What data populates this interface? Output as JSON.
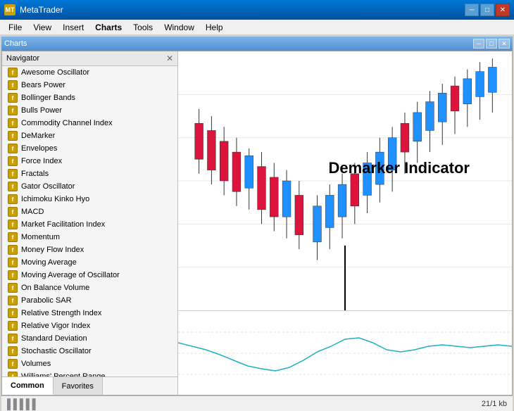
{
  "titleBar": {
    "icon": "MT",
    "title": "MetaTrader",
    "minimize": "─",
    "maximize": "□",
    "close": "✕"
  },
  "menuBar": {
    "items": [
      "File",
      "View",
      "Insert",
      "Charts",
      "Tools",
      "Window",
      "Help"
    ]
  },
  "innerWindow": {
    "title": "Charts",
    "minimize": "─",
    "maximize": "□",
    "close": "✕"
  },
  "navigator": {
    "title": "Navigator",
    "closeIcon": "✕",
    "items": [
      "Awesome Oscillator",
      "Bears Power",
      "Bollinger Bands",
      "Bulls Power",
      "Commodity Channel Index",
      "DeMarker",
      "Envelopes",
      "Force Index",
      "Fractals",
      "Gator Oscillator",
      "Ichimoku Kinko Hyo",
      "MACD",
      "Market Facilitation Index",
      "Momentum",
      "Money Flow Index",
      "Moving Average",
      "Moving Average of Oscillator",
      "On Balance Volume",
      "Parabolic SAR",
      "Relative Strength Index",
      "Relative Vigor Index",
      "Standard Deviation",
      "Stochastic Oscillator",
      "Volumes",
      "Williams' Percent Range"
    ],
    "tabs": [
      "Common",
      "Favorites"
    ]
  },
  "chart": {
    "label": "Demarker Indicator"
  },
  "statusBar": {
    "info": "21/1 kb"
  }
}
